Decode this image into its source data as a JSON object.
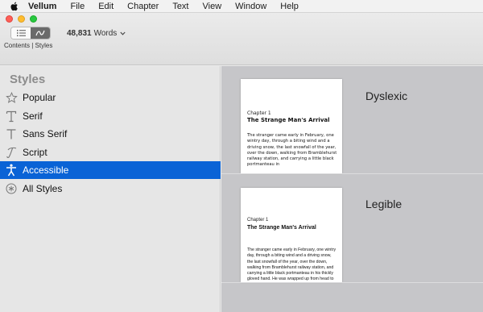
{
  "menubar": {
    "app_name": "Vellum",
    "items": [
      "File",
      "Edit",
      "Chapter",
      "Text",
      "View",
      "Window",
      "Help"
    ]
  },
  "toolbar": {
    "segmented_label": "Contents | Styles",
    "word_count": "48,831",
    "word_suffix": "Words"
  },
  "sidebar": {
    "title": "Styles",
    "items": [
      {
        "label": "Popular",
        "icon": "star-icon",
        "active": false
      },
      {
        "label": "Serif",
        "icon": "serif-t-icon",
        "active": false
      },
      {
        "label": "Sans Serif",
        "icon": "sans-t-icon",
        "active": false
      },
      {
        "label": "Script",
        "icon": "script-t-icon",
        "active": false
      },
      {
        "label": "Accessible",
        "icon": "accessibility-icon",
        "active": true
      },
      {
        "label": "All Styles",
        "icon": "asterisk-circle-icon",
        "active": false
      }
    ]
  },
  "previews": [
    {
      "style": "Dyslexic",
      "chapter": "Chapter 1",
      "title": "The Strange Man's Arrival",
      "body": "The stranger came early in February, one wintry day, through a biting wind and a driving snow, the last snowfall of the year, over the down, walking from Bramblehurst railway station, and carrying a little black portmanteau in"
    },
    {
      "style": "Legible",
      "chapter": "Chapter 1",
      "title": "The Strange Man's Arrival",
      "body": "The stranger came early in February, one wintry day, through a biting wind and a driving snow, the last snowfall of the year, over the down, walking from Bramblehurst railway station, and carrying a little black portmanteau in his thickly gloved hand. He was wrapped up from head to"
    }
  ],
  "colors": {
    "selection": "#0a63d6",
    "preview_background": "#c6c6c9"
  }
}
